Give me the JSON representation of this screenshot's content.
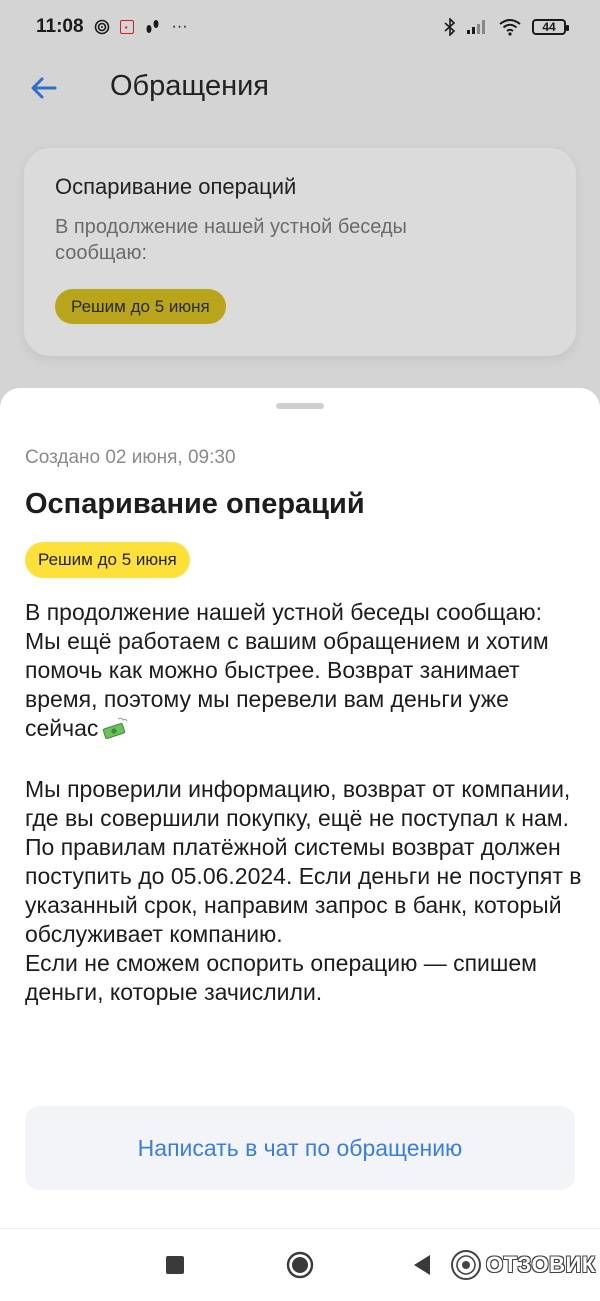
{
  "status_bar": {
    "time": "11:08",
    "icons": [
      "target-icon",
      "notification-red-icon",
      "footsteps-icon",
      "more-dots-icon",
      "bluetooth-icon",
      "signal-icon",
      "wifi-icon"
    ],
    "more": "···",
    "battery": "44"
  },
  "header": {
    "title": "Обращения"
  },
  "background_card": {
    "title": "Оспаривание операций",
    "preview": "В продолжение нашей устной беседы сообщаю:",
    "badge": "Решим до 5 июня"
  },
  "sheet": {
    "created": "Создано 02 июня, 09:30",
    "title": "Оспаривание операций",
    "badge": "Решим до 5 июня",
    "badge_color": "#fde13a",
    "message": {
      "p1": "В продолжение нашей устной беседы сообщаю:",
      "p2": "Мы ещё работаем с вашим обращением и хотим помочь как можно быстрее. Возврат занимает время, поэтому мы перевели вам деньги уже сейчас",
      "p2_icon": "flying-money-icon",
      "p3": "Мы проверили информацию, возврат от компании, где вы совершили покупку, ещё не поступал к нам. По правилам платёжной системы возврат должен поступить до 05.06.2024. Если деньги не поступят в указанный срок, направим запрос в банк, который обслуживает компанию.",
      "p4": "Если не сможем оспорить операцию — спишем деньги, которые зачислили."
    },
    "chat_button": "Написать в чат по обращению",
    "accent": "#3a7ee0"
  },
  "nav": {
    "items": [
      "recents-square-icon",
      "home-circle-icon",
      "back-triangle-icon"
    ]
  },
  "watermark": {
    "text": "ОТЗОВИК"
  }
}
